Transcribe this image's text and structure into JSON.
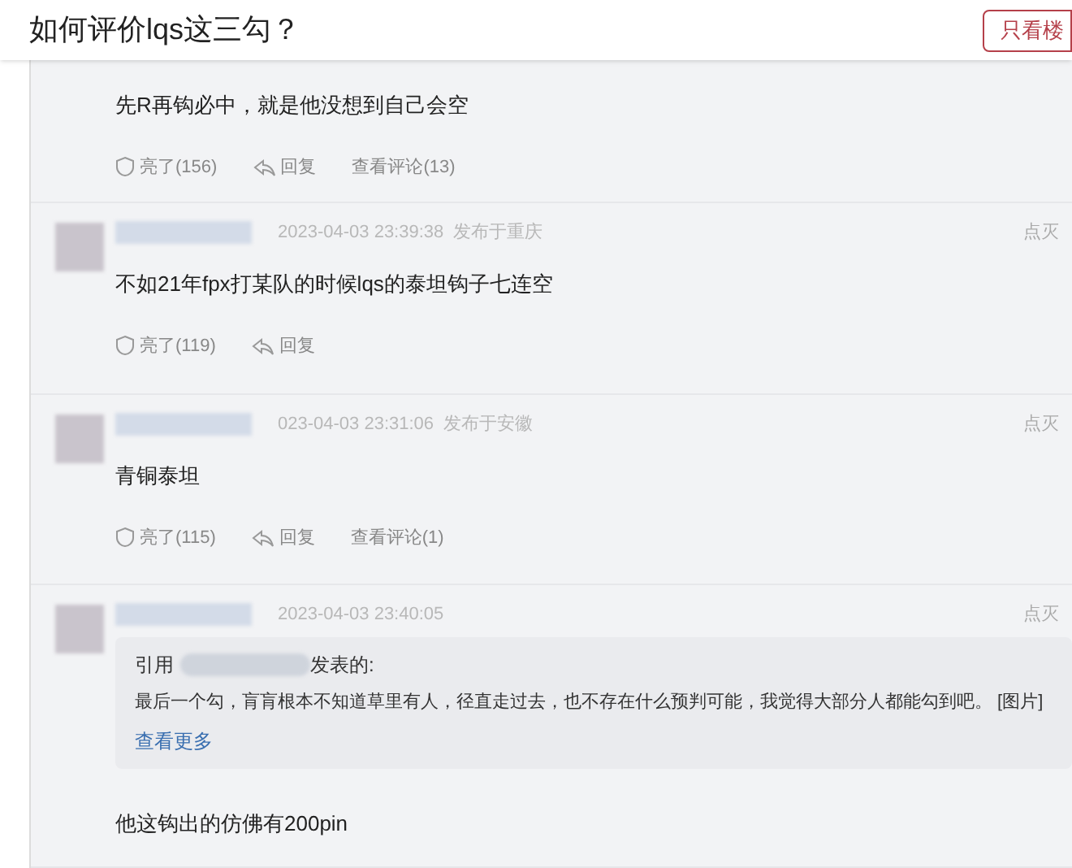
{
  "header": {
    "title": "如何评价lqs这三勾？",
    "button": "只看楼"
  },
  "posts": [
    {
      "text": "先R再钩必中，就是他没想到自己会空",
      "actions": [
        {
          "kind": "like",
          "label": "亮了(156)"
        },
        {
          "kind": "reply",
          "label": "回复"
        },
        {
          "kind": "comments",
          "label": "查看评论(13)"
        }
      ]
    },
    {
      "time": "2023-04-03 23:39:38",
      "location": "发布于重庆",
      "report": "点灭",
      "text": "不如21年fpx打某队的时候lqs的泰坦钩子七连空",
      "actions": [
        {
          "kind": "like",
          "label": "亮了(119)"
        },
        {
          "kind": "reply",
          "label": "回复"
        }
      ]
    },
    {
      "time": "023-04-03 23:31:06",
      "location": "发布于安徽",
      "report": "点灭",
      "text": "青铜泰坦",
      "actions": [
        {
          "kind": "like",
          "label": "亮了(115)"
        },
        {
          "kind": "reply",
          "label": "回复"
        },
        {
          "kind": "comments",
          "label": "查看评论(1)"
        }
      ]
    },
    {
      "time": "2023-04-03 23:40:05",
      "report": "点灭",
      "quote": {
        "prefix": "引用",
        "suffix": "发表的:",
        "text": "最后一个勾，肓肓根本不知道草里有人，径直走过去，也不存在什么预判可能，我觉得大部分人都能勾到吧。 [图片]",
        "more": "查看更多"
      },
      "text": "他这钩出的仿佛有200pin"
    }
  ]
}
